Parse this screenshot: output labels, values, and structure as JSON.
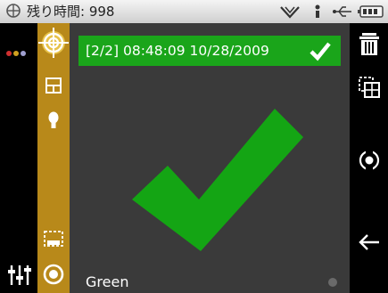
{
  "status_bar": {
    "time_label": "残り時間: 998",
    "icons": [
      "globe-icon",
      "wifi-icon",
      "bluetooth-icon",
      "usb-icon",
      "battery-icon"
    ]
  },
  "left_column": {
    "icons": [
      "color-dots-icon",
      "settings-sliders-icon"
    ],
    "dot_colors": [
      "#d03030",
      "#d0a020",
      "#a0a0d0"
    ]
  },
  "tool_bar": {
    "icons": [
      "target-icon",
      "grid-icon",
      "lightbulb-icon",
      "dashed-frame-icon",
      "record-icon"
    ],
    "accent": "#b8891a"
  },
  "main": {
    "banner_text": "[2/2] 08:48:09 10/28/2009",
    "banner_color": "#1aa51a",
    "bottom_label": "Green",
    "check_color": "#14a514"
  },
  "right_column": {
    "icons": [
      "trash-icon",
      "copy-frames-icon",
      "target-view-icon",
      "back-arrow-icon"
    ]
  }
}
